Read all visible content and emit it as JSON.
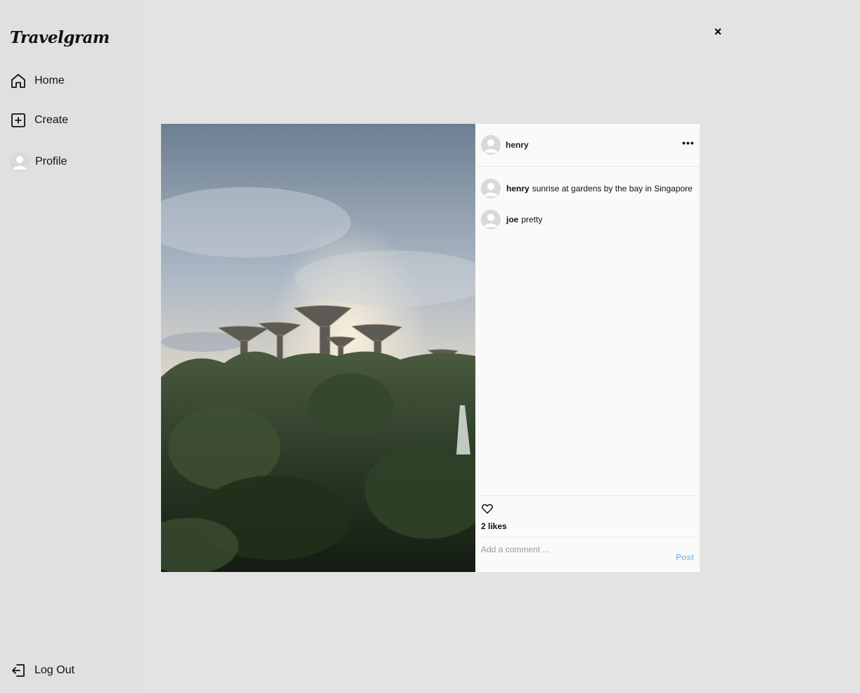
{
  "app": {
    "logo": "Travelgram"
  },
  "sidebar": {
    "items": [
      {
        "label": "Home",
        "icon": "home-icon"
      },
      {
        "label": "Create",
        "icon": "plus-square-icon"
      },
      {
        "label": "Profile",
        "icon": "avatar"
      }
    ],
    "logout": {
      "label": "Log Out",
      "icon": "logout-icon"
    }
  },
  "modal": {
    "close_label": "×",
    "author": "henry",
    "more_label": "•••",
    "comments": [
      {
        "user": "henry",
        "text": "sunrise at gardens by the bay in Singapore"
      },
      {
        "user": "joe",
        "text": "pretty"
      }
    ],
    "likes": "2 likes",
    "comment_placeholder": "Add a comment ...",
    "post_label": "Post"
  },
  "colors": {
    "background": "#e3e3e3",
    "panel": "#fafaf8",
    "post_button": "#8fc3ee"
  }
}
